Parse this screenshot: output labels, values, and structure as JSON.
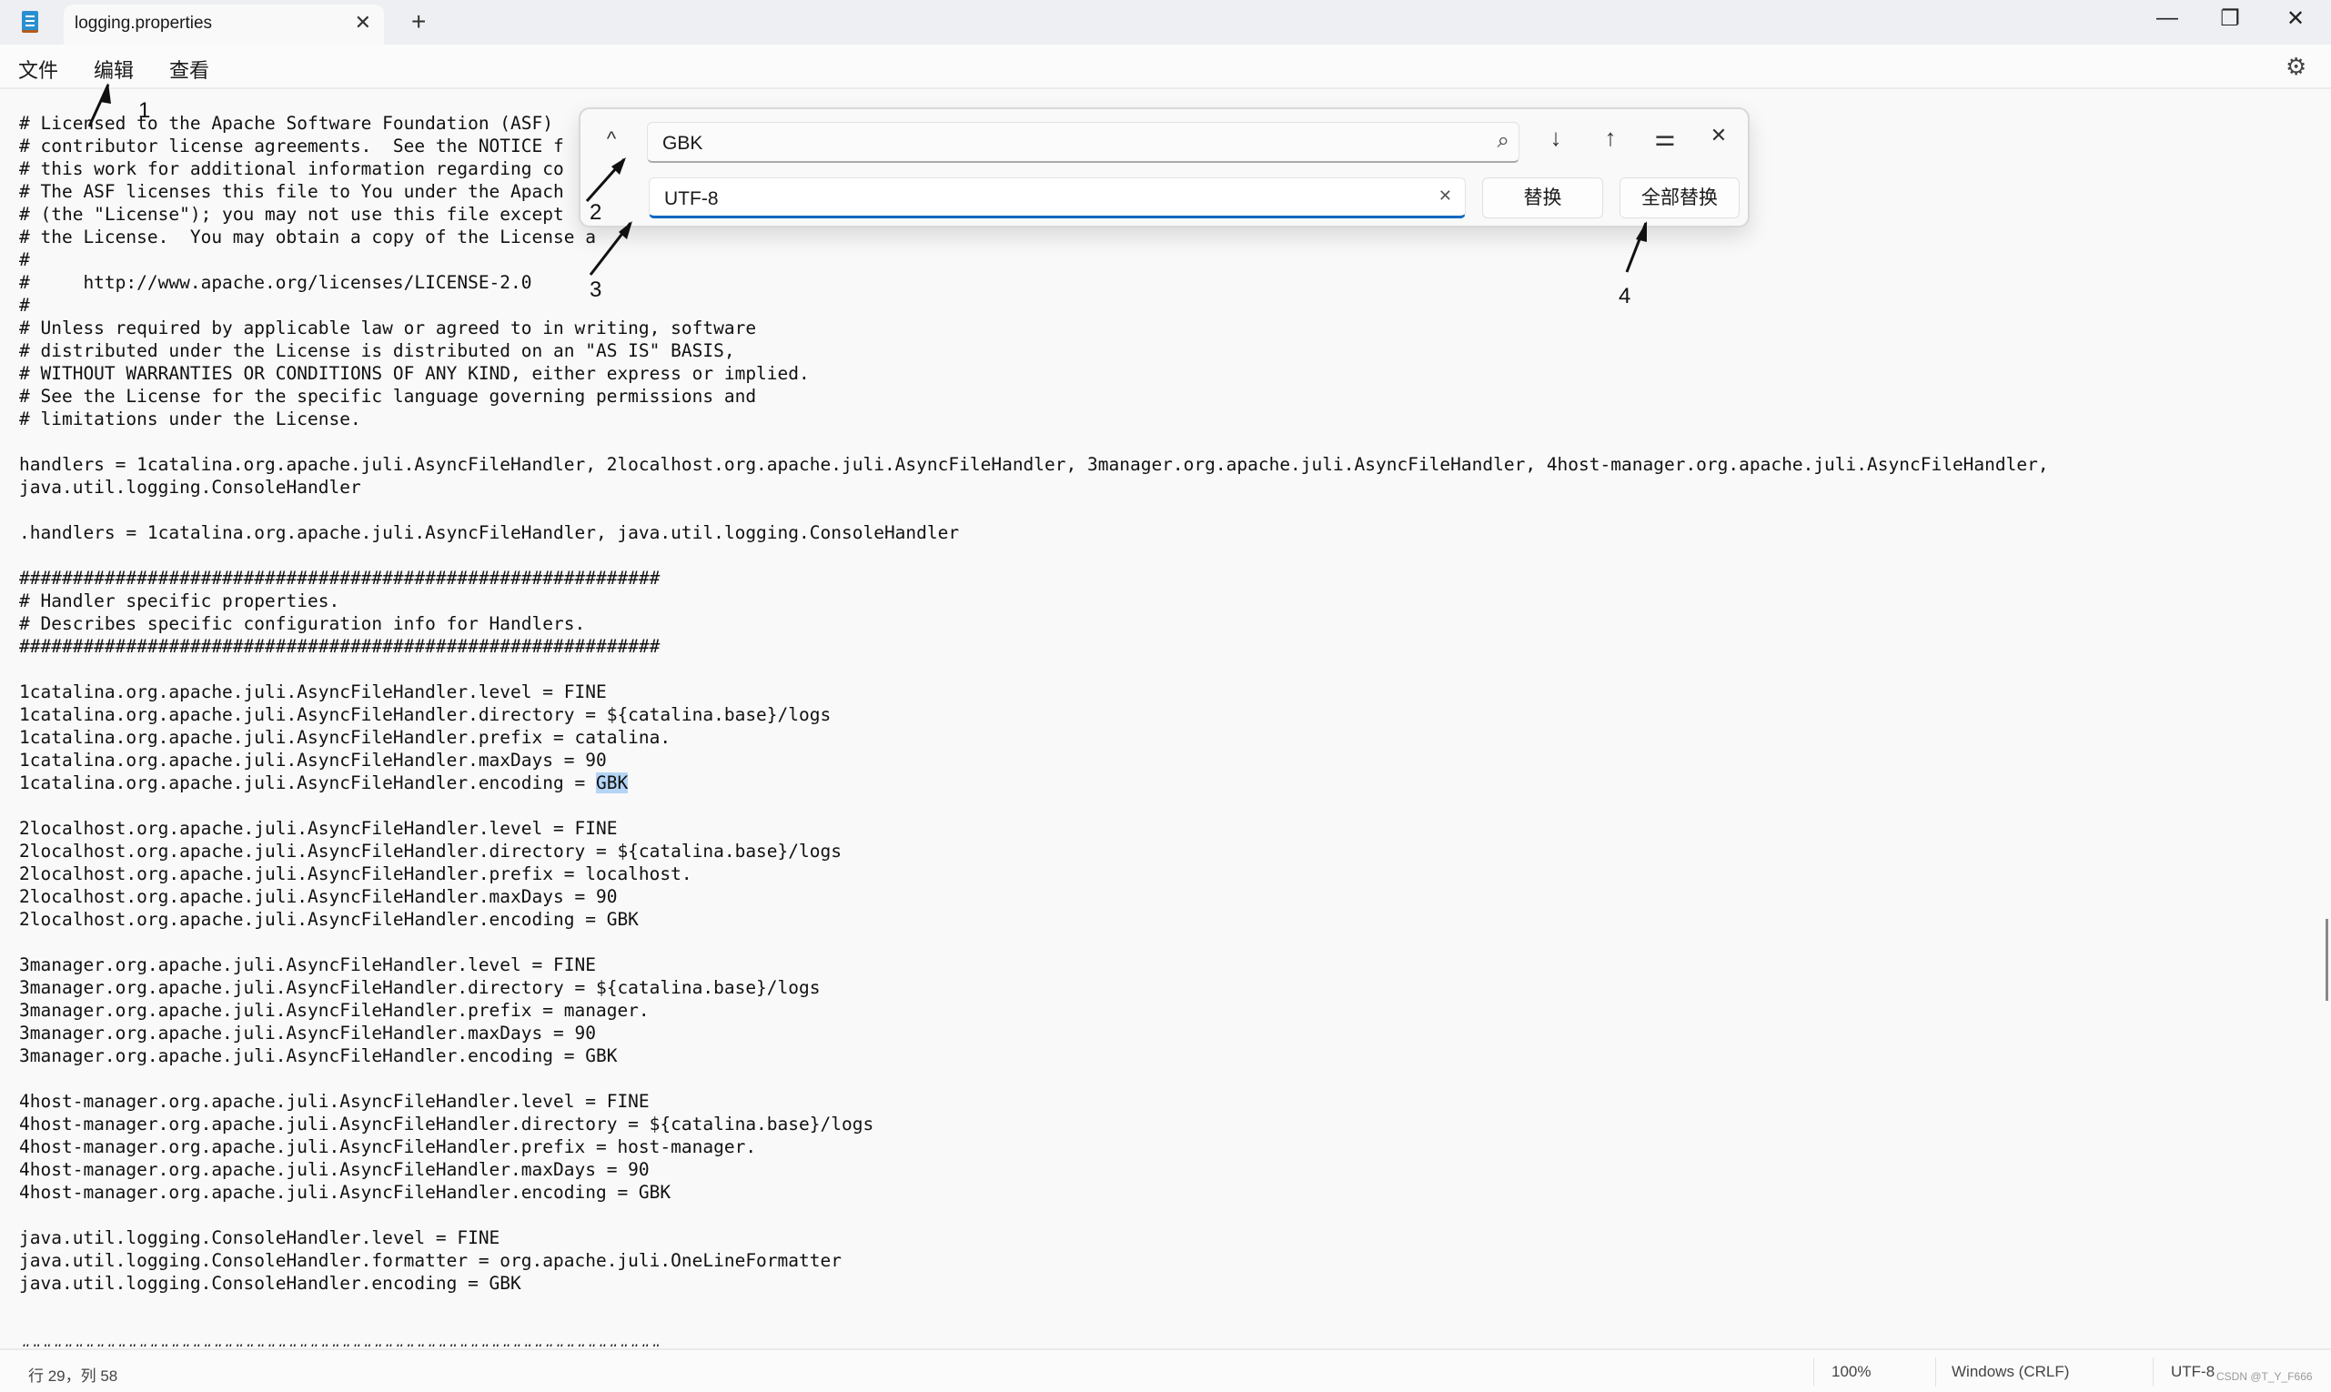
{
  "window": {
    "tab_title": "logging.properties",
    "new_tab": "+",
    "minimize": "—",
    "maximize": "❐",
    "close": "✕"
  },
  "menu": {
    "items": [
      "文件",
      "编辑",
      "查看"
    ],
    "settings_icon": "gear-icon"
  },
  "editor": {
    "lines": [
      {
        "text": "# Licensed to the Apache Software Foundation (ASF)"
      },
      {
        "text": "# contributor license agreements.  See the NOTICE f"
      },
      {
        "text": "# this work for additional information regarding co"
      },
      {
        "text": "# The ASF licenses this file to You under the Apach"
      },
      {
        "text": "# (the \"License\"); you may not use this file except"
      },
      {
        "text": "# the License.  You may obtain a copy of the License a"
      },
      {
        "text": "#"
      },
      {
        "text": "#     http://www.apache.org/licenses/LICENSE-2.0"
      },
      {
        "text": "#"
      },
      {
        "text": "# Unless required by applicable law or agreed to in writing, software"
      },
      {
        "text": "# distributed under the License is distributed on an \"AS IS\" BASIS,"
      },
      {
        "text": "# WITHOUT WARRANTIES OR CONDITIONS OF ANY KIND, either express or implied."
      },
      {
        "text": "# See the License for the specific language governing permissions and"
      },
      {
        "text": "# limitations under the License."
      },
      {
        "text": ""
      },
      {
        "text": "handlers = 1catalina.org.apache.juli.AsyncFileHandler, 2localhost.org.apache.juli.AsyncFileHandler, 3manager.org.apache.juli.AsyncFileHandler, 4host-manager.org.apache.juli.AsyncFileHandler,"
      },
      {
        "text": "java.util.logging.ConsoleHandler"
      },
      {
        "text": ""
      },
      {
        "text": ".handlers = 1catalina.org.apache.juli.AsyncFileHandler, java.util.logging.ConsoleHandler"
      },
      {
        "text": ""
      },
      {
        "text": "############################################################"
      },
      {
        "text": "# Handler specific properties."
      },
      {
        "text": "# Describes specific configuration info for Handlers."
      },
      {
        "text": "############################################################"
      },
      {
        "text": ""
      },
      {
        "text": "1catalina.org.apache.juli.AsyncFileHandler.level = FINE"
      },
      {
        "text": "1catalina.org.apache.juli.AsyncFileHandler.directory = ${catalina.base}/logs"
      },
      {
        "text": "1catalina.org.apache.juli.AsyncFileHandler.prefix = catalina."
      },
      {
        "text": "1catalina.org.apache.juli.AsyncFileHandler.maxDays = 90"
      },
      {
        "text": "1catalina.org.apache.juli.AsyncFileHandler.encoding = ",
        "match": "GBK"
      },
      {
        "text": ""
      },
      {
        "text": "2localhost.org.apache.juli.AsyncFileHandler.level = FINE"
      },
      {
        "text": "2localhost.org.apache.juli.AsyncFileHandler.directory = ${catalina.base}/logs"
      },
      {
        "text": "2localhost.org.apache.juli.AsyncFileHandler.prefix = localhost."
      },
      {
        "text": "2localhost.org.apache.juli.AsyncFileHandler.maxDays = 90"
      },
      {
        "text": "2localhost.org.apache.juli.AsyncFileHandler.encoding = GBK"
      },
      {
        "text": ""
      },
      {
        "text": "3manager.org.apache.juli.AsyncFileHandler.level = FINE"
      },
      {
        "text": "3manager.org.apache.juli.AsyncFileHandler.directory = ${catalina.base}/logs"
      },
      {
        "text": "3manager.org.apache.juli.AsyncFileHandler.prefix = manager."
      },
      {
        "text": "3manager.org.apache.juli.AsyncFileHandler.maxDays = 90"
      },
      {
        "text": "3manager.org.apache.juli.AsyncFileHandler.encoding = GBK"
      },
      {
        "text": ""
      },
      {
        "text": "4host-manager.org.apache.juli.AsyncFileHandler.level = FINE"
      },
      {
        "text": "4host-manager.org.apache.juli.AsyncFileHandler.directory = ${catalina.base}/logs"
      },
      {
        "text": "4host-manager.org.apache.juli.AsyncFileHandler.prefix = host-manager."
      },
      {
        "text": "4host-manager.org.apache.juli.AsyncFileHandler.maxDays = 90"
      },
      {
        "text": "4host-manager.org.apache.juli.AsyncFileHandler.encoding = GBK"
      },
      {
        "text": ""
      },
      {
        "text": "java.util.logging.ConsoleHandler.level = FINE"
      },
      {
        "text": "java.util.logging.ConsoleHandler.formatter = org.apache.juli.OneLineFormatter"
      },
      {
        "text": "java.util.logging.ConsoleHandler.encoding = GBK"
      },
      {
        "text": ""
      },
      {
        "text": ""
      },
      {
        "text": "############################################################"
      }
    ],
    "match_color": "#b4d5f5"
  },
  "find_replace": {
    "find_value": "GBK",
    "replace_value": "UTF-8",
    "replace_label": "替换",
    "replace_all_label": "全部替换",
    "collapse": "^",
    "search": "⌕",
    "next": "↓",
    "prev": "↑",
    "options": "⚌",
    "close": "✕",
    "clear": "✕",
    "accent": "#0067c0"
  },
  "annotations": [
    "1",
    "2",
    "3",
    "4"
  ],
  "status": {
    "position": "行 29，列 58",
    "zoom": "100%",
    "line_ending": "Windows (CRLF)",
    "encoding": "UTF-8",
    "watermark": "CSDN @T_Y_F666"
  }
}
